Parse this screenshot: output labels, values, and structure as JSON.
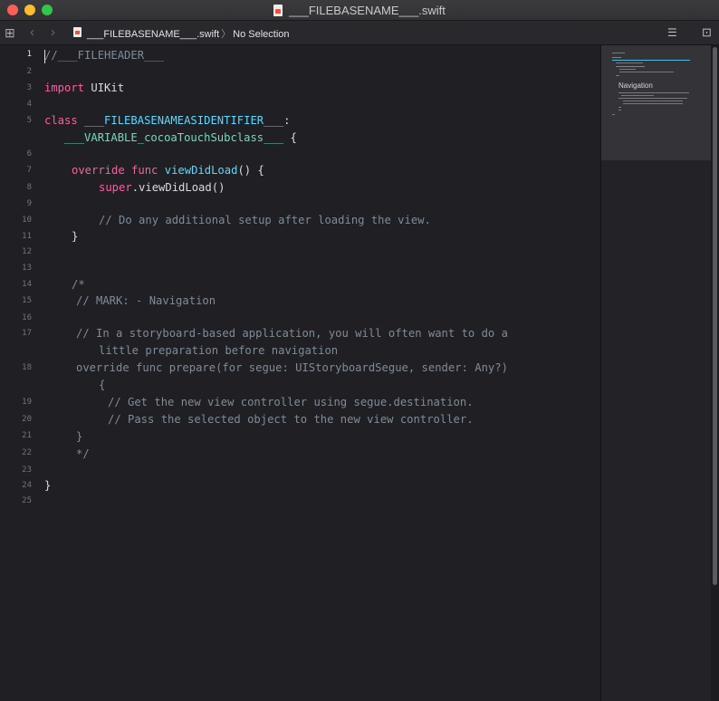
{
  "window": {
    "title": "___FILEBASENAME___.swift"
  },
  "jumpbar": {
    "file_name": "___FILEBASENAME___.swift",
    "separator": "〉",
    "selection": "No Selection"
  },
  "editor": {
    "line_numbers": [
      "1",
      "2",
      "3",
      "4",
      "5",
      "6",
      "7",
      "8",
      "9",
      "10",
      "11",
      "12",
      "13",
      "14",
      "15",
      "16",
      "17",
      "18",
      "19",
      "20",
      "21",
      "22",
      "23",
      "24",
      "25"
    ],
    "active_line": "1",
    "tokens": {
      "l1": "//___FILEHEADER___",
      "l3_kw": "import",
      "l3_rest": " UIKit",
      "l5_kw": "class",
      "l5_name": "___FILEBASENAMEASIDENTIFIER___",
      "l5_colon": ":",
      "l5b_indent": "   ",
      "l5b_super": "___VARIABLE_cocoaTouchSubclass___",
      "l5b_brace": " {",
      "l7_kw": "override func",
      "l7_name": "viewDidLoad",
      "l7_rest": "() {",
      "l8_kw": "super",
      "l8_rest": ".viewDidLoad()",
      "l10": "// Do any additional setup after loading the view.",
      "l11": "}",
      "l14": "/*",
      "l15": "// MARK: - Navigation",
      "l17a": "// In a storyboard-based application, you will often want to do a",
      "l17b": "little preparation before navigation",
      "l18a": "override func prepare(for segue: UIStoryboardSegue, sender: Any?)",
      "l18b": "{",
      "l19": "// Get the new view controller using segue.destination.",
      "l20": "// Pass the selected object to the new view controller.",
      "l21": "}",
      "l22": "*/",
      "l24": "}"
    }
  },
  "minimap": {
    "mark_label": "Navigation"
  },
  "colors": {
    "keyword": "#fc5fa3",
    "comment": "#7f8c98",
    "declaration": "#5dd8ff",
    "placeholder": "#6bdfb6",
    "background": "#1f1f24"
  },
  "icons": {
    "related_items": "grid-icon",
    "back": "chevron-left-icon",
    "forward": "chevron-right-icon",
    "file": "swift-file-icon",
    "adjust_editor": "editor-options-icon",
    "add_editor": "split-editor-icon"
  }
}
